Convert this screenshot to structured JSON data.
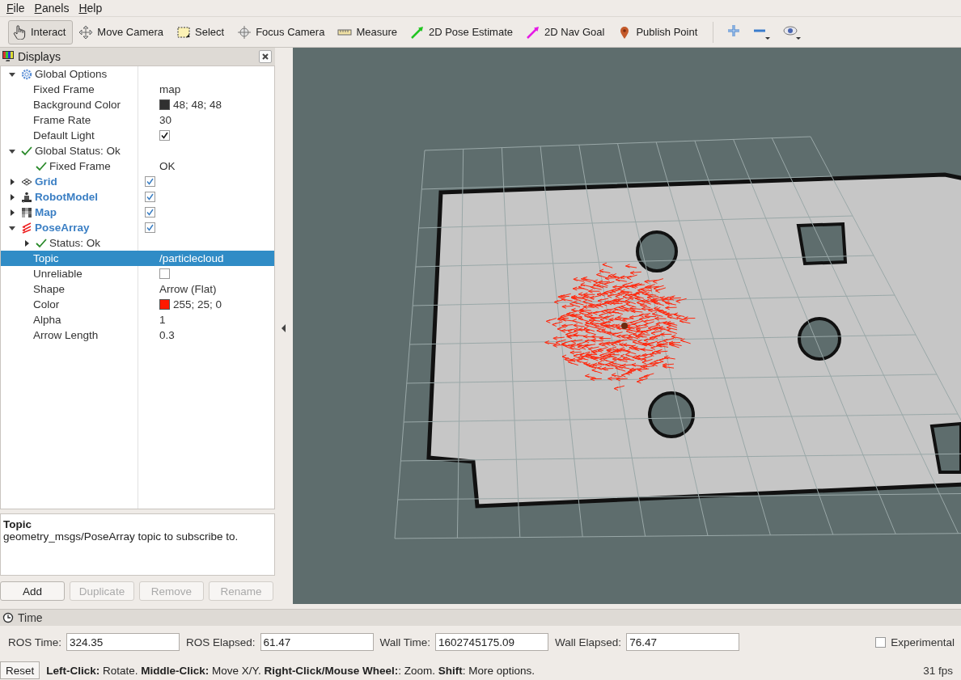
{
  "menu": [
    {
      "label": "File"
    },
    {
      "label": "Panels"
    },
    {
      "label": "Help"
    }
  ],
  "toolbar": [
    {
      "label": "Interact",
      "selected": true
    },
    {
      "label": "Move Camera",
      "selected": false
    },
    {
      "label": "Select",
      "selected": false
    },
    {
      "label": "Focus Camera",
      "selected": false
    },
    {
      "label": "Measure",
      "selected": false
    },
    {
      "label": "2D Pose Estimate",
      "selected": false
    },
    {
      "label": "2D Nav Goal",
      "selected": false
    },
    {
      "label": "Publish Point",
      "selected": false
    }
  ],
  "displays": {
    "title": "Displays",
    "tree": [
      {
        "kind": "category",
        "label": "Global Options",
        "expanded": true,
        "selected": false,
        "children": [
          {
            "kind": "property",
            "label": "Fixed Frame",
            "value": "map",
            "selected": false
          },
          {
            "kind": "property",
            "label": "Background Color",
            "value": "48; 48; 48",
            "color": "#303030",
            "selected": false
          },
          {
            "kind": "property",
            "label": "Frame Rate",
            "value": "30",
            "selected": false
          },
          {
            "kind": "property",
            "label": "Default Light",
            "checked": true,
            "selected": false
          }
        ]
      },
      {
        "kind": "status",
        "label": "Global Status: Ok",
        "expanded": true,
        "selected": false,
        "children": [
          {
            "kind": "status",
            "label": "Fixed Frame",
            "value": "OK",
            "selected": false
          }
        ]
      },
      {
        "kind": "display",
        "label": "Grid",
        "expanded": false,
        "checked": true,
        "selected": false
      },
      {
        "kind": "display",
        "label": "RobotModel",
        "expanded": false,
        "checked": true,
        "selected": false
      },
      {
        "kind": "display",
        "label": "Map",
        "expanded": false,
        "checked": true,
        "selected": false
      },
      {
        "kind": "display",
        "label": "PoseArray",
        "expanded": true,
        "checked": true,
        "selected": false,
        "children": [
          {
            "kind": "status",
            "label": "Status: Ok",
            "expanded": false,
            "selected": false
          },
          {
            "kind": "property",
            "label": "Topic",
            "value": "/particlecloud",
            "selected": true
          },
          {
            "kind": "property",
            "label": "Unreliable",
            "checked": false,
            "selected": false
          },
          {
            "kind": "property",
            "label": "Shape",
            "value": "Arrow (Flat)",
            "selected": false
          },
          {
            "kind": "property",
            "label": "Color",
            "value": "255; 25; 0",
            "color": "#ff1900",
            "selected": false
          },
          {
            "kind": "property",
            "label": "Alpha",
            "value": "1",
            "selected": false
          },
          {
            "kind": "property",
            "label": "Arrow Length",
            "value": "0.3",
            "selected": false
          }
        ]
      }
    ],
    "description": {
      "title": "Topic",
      "text": "geometry_msgs/PoseArray topic to subscribe to."
    },
    "buttons": [
      {
        "label": "Add",
        "disabled": false
      },
      {
        "label": "Duplicate",
        "disabled": true
      },
      {
        "label": "Remove",
        "disabled": true
      },
      {
        "label": "Rename",
        "disabled": true
      }
    ]
  },
  "time": {
    "title": "Time",
    "fields": [
      {
        "label": "ROS Time:",
        "value": "324.35"
      },
      {
        "label": "ROS Elapsed:",
        "value": "61.47"
      },
      {
        "label": "Wall Time:",
        "value": "1602745175.09"
      },
      {
        "label": "Wall Elapsed:",
        "value": "76.47"
      }
    ],
    "experimental": {
      "label": "Experimental",
      "checked": false
    }
  },
  "status_bar": {
    "reset": "Reset",
    "hint": "**Left-Click:** Rotate. **Middle-Click:** Move X/Y. **Right-Click/Mouse Wheel:**: Zoom. **Shift**: More options.",
    "fps": "31 fps"
  }
}
